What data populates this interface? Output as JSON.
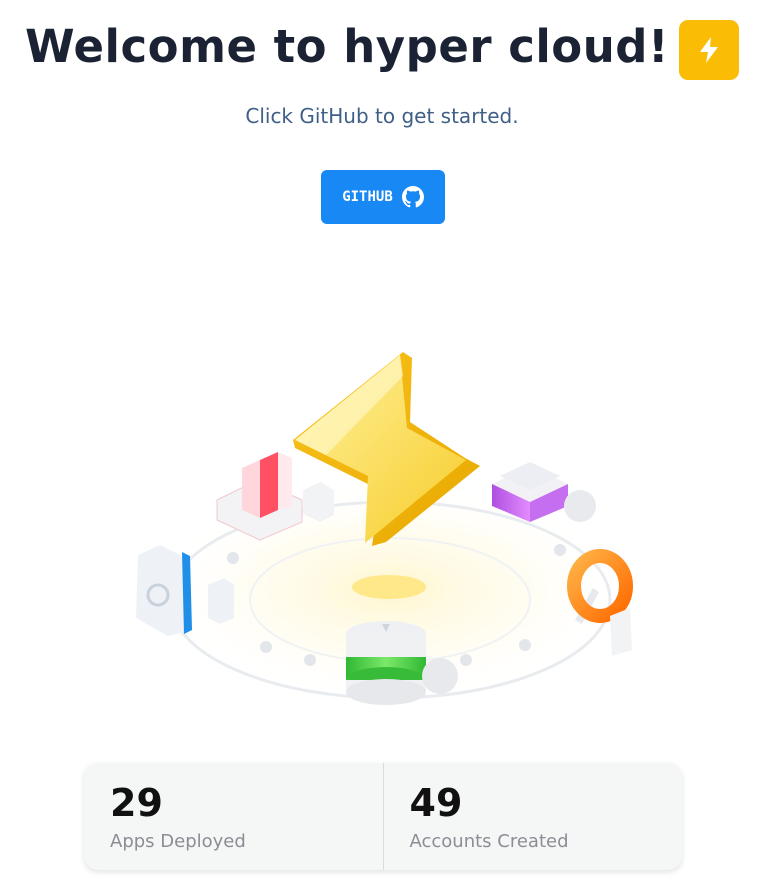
{
  "header": {
    "title": "Welcome to hyper cloud!",
    "badge_icon": "lightning-bolt-icon",
    "badge_color": "#fbbc05"
  },
  "intro": {
    "subtitle": "Click GitHub to get started."
  },
  "github_button": {
    "label": "GITHUB",
    "icon": "github-icon",
    "color": "#1788f4"
  },
  "illustration": {
    "description_icon": "cloud-services-illustration"
  },
  "stats": [
    {
      "value": "29",
      "label": "Apps Deployed"
    },
    {
      "value": "49",
      "label": "Accounts Created"
    }
  ]
}
